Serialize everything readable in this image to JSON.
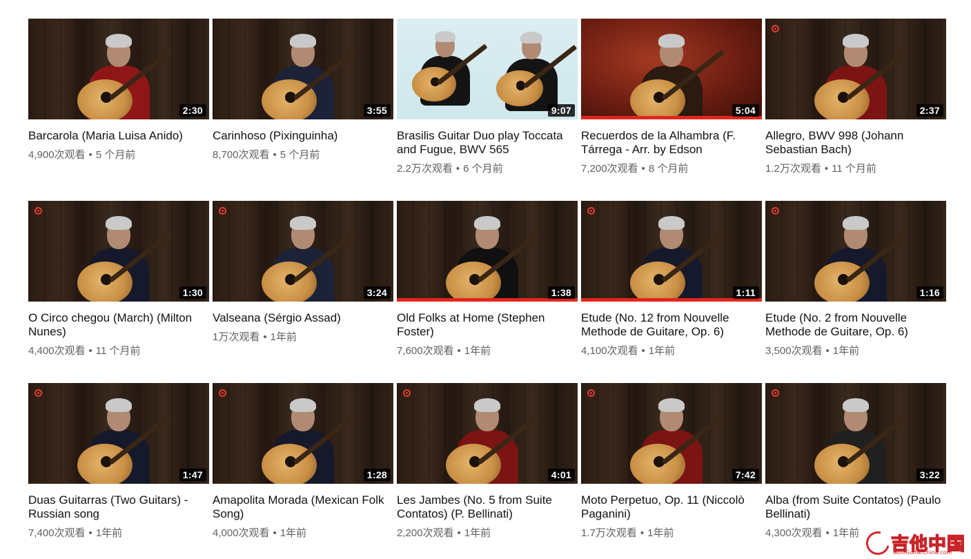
{
  "accent_color": "#e1261c",
  "videos": [
    {
      "title": "Barcarola (Maria Luisa Anido)",
      "views": "4,900次观看",
      "age": "5 个月前",
      "duration": "2:30",
      "scene": "wood",
      "shirt": "#8f1616",
      "logo": false,
      "progress": 0
    },
    {
      "title": "Carinhoso (Pixinguinha)",
      "views": "8,700次观看",
      "age": "5 个月前",
      "duration": "3:55",
      "scene": "wood",
      "shirt": "#1c2238",
      "logo": false,
      "progress": 0
    },
    {
      "title": "Brasilis Guitar Duo play Toccata and Fugue, BWV 565",
      "views": "2.2万次观看",
      "age": "6 个月前",
      "duration": "9:07",
      "scene": "studio",
      "shirt": "#141414",
      "logo": false,
      "progress": 0
    },
    {
      "title": "Recuerdos de la Alhambra (F. Tárrega - Arr. by Edson",
      "views": "7,200次观看",
      "age": "8 个月前",
      "duration": "5:04",
      "scene": "painting",
      "shirt": "#2a1a10",
      "logo": false,
      "progress": 1.0
    },
    {
      "title": "Allegro, BWV 998 (Johann Sebastian Bach)",
      "views": "1.2万次观看",
      "age": "11 个月前",
      "duration": "2:37",
      "scene": "wood",
      "shirt": "#7c1414",
      "logo": true,
      "progress": 0
    },
    {
      "title": "O Circo chegou (March) (Milton Nunes)",
      "views": "4,400次观看",
      "age": "11 个月前",
      "duration": "1:30",
      "scene": "wood",
      "shirt": "#15192b",
      "logo": true,
      "progress": 0
    },
    {
      "title": "Valseana (Sérgio Assad)",
      "views": "1万次观看",
      "age": "1年前",
      "duration": "3:24",
      "scene": "wood",
      "shirt": "#1c2238",
      "logo": true,
      "progress": 0
    },
    {
      "title": "Old Folks at Home (Stephen Foster)",
      "views": "7,600次观看",
      "age": "1年前",
      "duration": "1:38",
      "scene": "wood",
      "shirt": "#101010",
      "logo": false,
      "progress": 1.0
    },
    {
      "title": "Etude (No. 12 from Nouvelle Methode de Guitare, Op. 6)",
      "views": "4,100次观看",
      "age": "1年前",
      "duration": "1:11",
      "scene": "wood",
      "shirt": "#15192b",
      "logo": true,
      "progress": 1.0
    },
    {
      "title": "Etude (No. 2 from Nouvelle Methode de Guitare, Op. 6)",
      "views": "3,500次观看",
      "age": "1年前",
      "duration": "1:16",
      "scene": "wood",
      "shirt": "#15192b",
      "logo": true,
      "progress": 0
    },
    {
      "title": "Duas Guitarras (Two Guitars) - Russian song",
      "views": "7,400次观看",
      "age": "1年前",
      "duration": "1:47",
      "scene": "wood",
      "shirt": "#15192b",
      "logo": true,
      "progress": 0
    },
    {
      "title": "Amapolita Morada (Mexican Folk Song)",
      "views": "4,000次观看",
      "age": "1年前",
      "duration": "1:28",
      "scene": "wood",
      "shirt": "#15192b",
      "logo": true,
      "progress": 0
    },
    {
      "title": "Les Jambes (No. 5 from Suite Contatos) (P. Bellinati)",
      "views": "2,200次观看",
      "age": "1年前",
      "duration": "4:01",
      "scene": "wood",
      "shirt": "#7c1414",
      "logo": true,
      "progress": 0
    },
    {
      "title": "Moto Perpetuo, Op. 11 (Niccolò Paganini)",
      "views": "1.7万次观看",
      "age": "1年前",
      "duration": "7:42",
      "scene": "wood",
      "shirt": "#7c1414",
      "logo": true,
      "progress": 0
    },
    {
      "title": "Alba (from Suite Contatos) (Paulo Bellinati)",
      "views": "4,300次观看",
      "age": "1年前",
      "duration": "3:22",
      "scene": "wood",
      "shirt": "#202020",
      "logo": true,
      "progress": 0
    }
  ],
  "watermark": {
    "text": "吉他中国",
    "sub": "bbs.GuitarChina.com"
  }
}
